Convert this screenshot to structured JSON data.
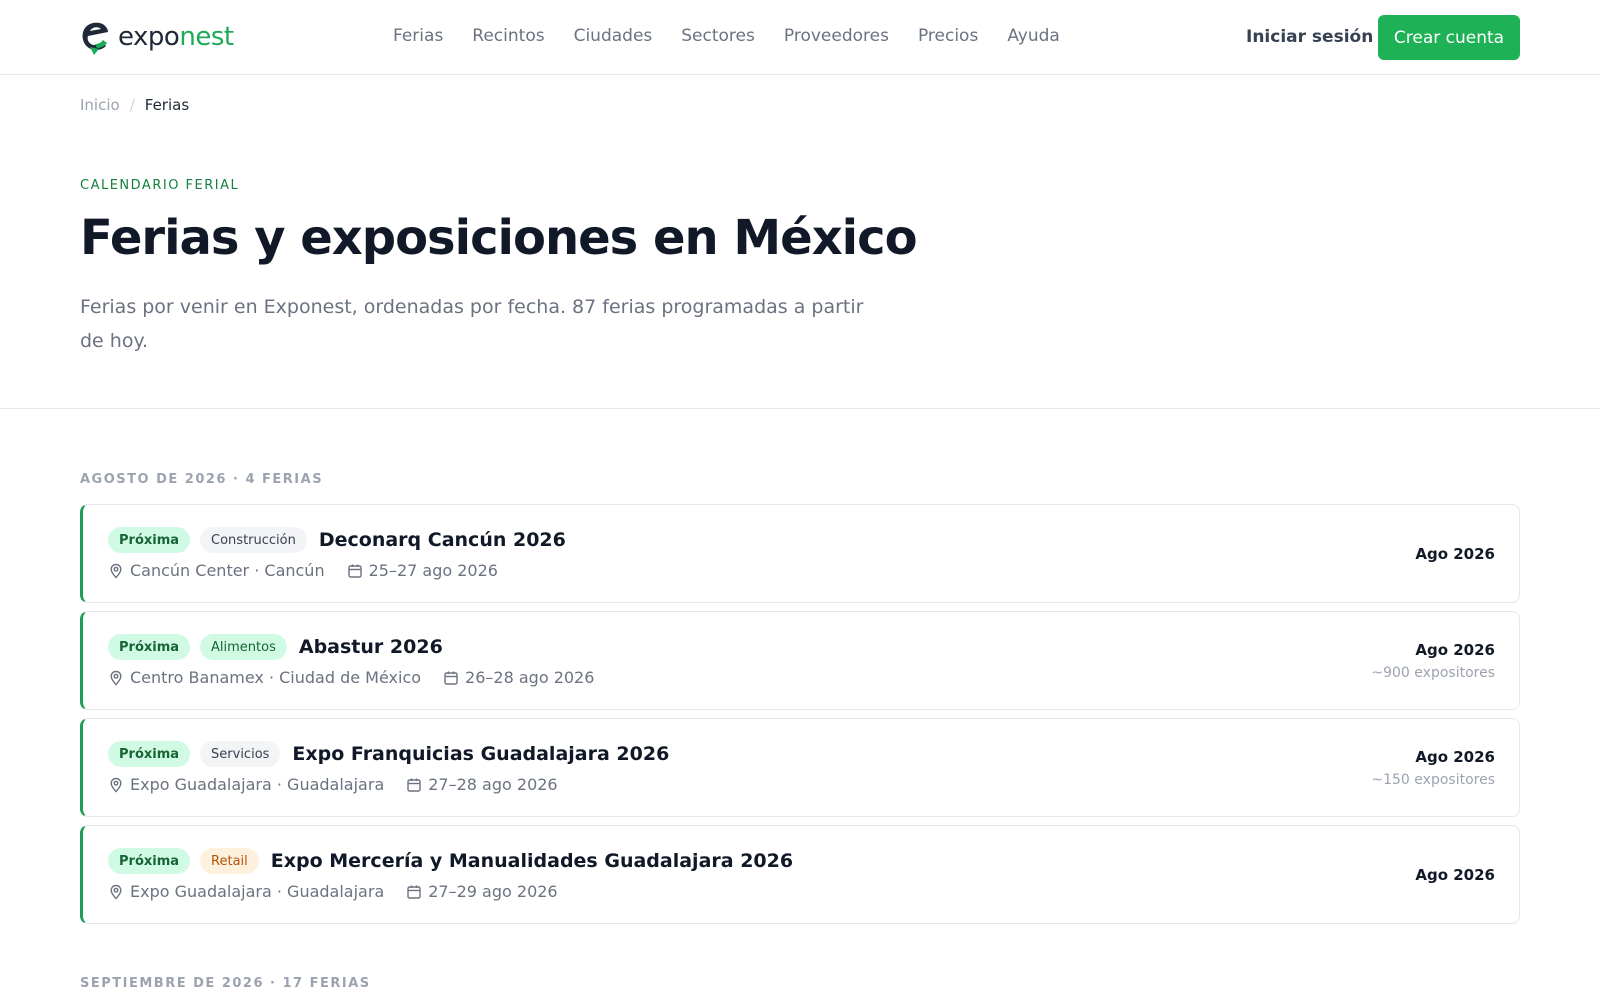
{
  "header": {
    "logo_prefix": "expo",
    "logo_suffix": "nest",
    "nav": [
      "Ferias",
      "Recintos",
      "Ciudades",
      "Sectores",
      "Proveedores",
      "Precios",
      "Ayuda"
    ],
    "login_label": "Iniciar sesión",
    "signup_label": "Crear cuenta"
  },
  "breadcrumb": {
    "home": "Inicio",
    "separator": "/",
    "current": "Ferias"
  },
  "hero": {
    "eyebrow": "CALENDARIO FERIAL",
    "title": "Ferias y exposiciones en México",
    "subtitle": "Ferias por venir en Exponest, ordenadas por fecha. 87 ferias programadas a partir de hoy."
  },
  "sections": [
    {
      "heading": "AGOSTO DE 2026 · 4 FERIAS",
      "events": [
        {
          "status": "Próxima",
          "sector": "Construcción",
          "sector_color": "#f3f4f6",
          "title": "Deconarq Cancún 2026",
          "location": "Cancún Center · Cancún",
          "dates": "25–27 ago 2026",
          "month": "Ago 2026",
          "exhibitors": ""
        },
        {
          "status": "Próxima",
          "sector": "Alimentos",
          "sector_color": "#d1fae5",
          "title": "Abastur 2026",
          "location": "Centro Banamex · Ciudad de México",
          "dates": "26–28 ago 2026",
          "month": "Ago 2026",
          "exhibitors": "~900 expositores"
        },
        {
          "status": "Próxima",
          "sector": "Servicios",
          "sector_color": "#f3f4f6",
          "title": "Expo Franquicias Guadalajara 2026",
          "location": "Expo Guadalajara · Guadalajara",
          "dates": "27–28 ago 2026",
          "month": "Ago 2026",
          "exhibitors": "~150 expositores"
        },
        {
          "status": "Próxima",
          "sector": "Retail",
          "sector_color": "#fdf1de",
          "title": "Expo Mercería y Manualidades Guadalajara 2026",
          "location": "Expo Guadalajara · Guadalajara",
          "dates": "27–29 ago 2026",
          "month": "Ago 2026",
          "exhibitors": ""
        }
      ]
    },
    {
      "heading": "SEPTIEMBRE DE 2026 · 17 FERIAS",
      "events": []
    }
  ],
  "colors": {
    "brand": "#1eb155",
    "accent_border": "#1e9e55",
    "eyebrow": "#15803d"
  },
  "icons": {
    "location": "map-pin-icon",
    "date": "calendar-icon",
    "logo": "exponest-logo-icon"
  }
}
